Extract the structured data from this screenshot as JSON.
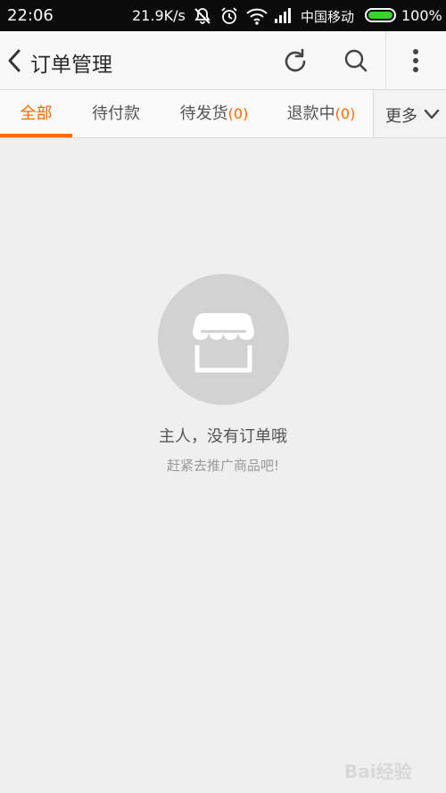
{
  "status_bar": {
    "time": "22:06",
    "net_speed": "21.9K/s",
    "carrier": "中国移动",
    "battery_pct": "100%",
    "icons": [
      "mute-icon",
      "alarm-icon",
      "wifi-icon",
      "signal-icon",
      "battery-icon"
    ],
    "battery_color": "#39d12b"
  },
  "header": {
    "title": "订单管理",
    "icons": [
      "back-arrow-icon",
      "refresh-icon",
      "search-icon",
      "more-vertical-icon"
    ]
  },
  "tabs": [
    {
      "label": "全部",
      "count": "",
      "active": true
    },
    {
      "label": "待付款",
      "count": "",
      "active": false
    },
    {
      "label": "待发货",
      "count": "(0)",
      "active": false
    },
    {
      "label": "退款中",
      "count": "(0)",
      "active": false
    }
  ],
  "tabs_more": {
    "label": "更多",
    "icon": "chevron-down-icon"
  },
  "empty_state": {
    "icon": "store-icon",
    "title": "主人，没有订单哦",
    "subtitle": "赶紧去推广商品吧!"
  },
  "watermark": {
    "text": "Bai经验"
  },
  "colors": {
    "accent": "#ff6a00",
    "background": "#efefef"
  }
}
